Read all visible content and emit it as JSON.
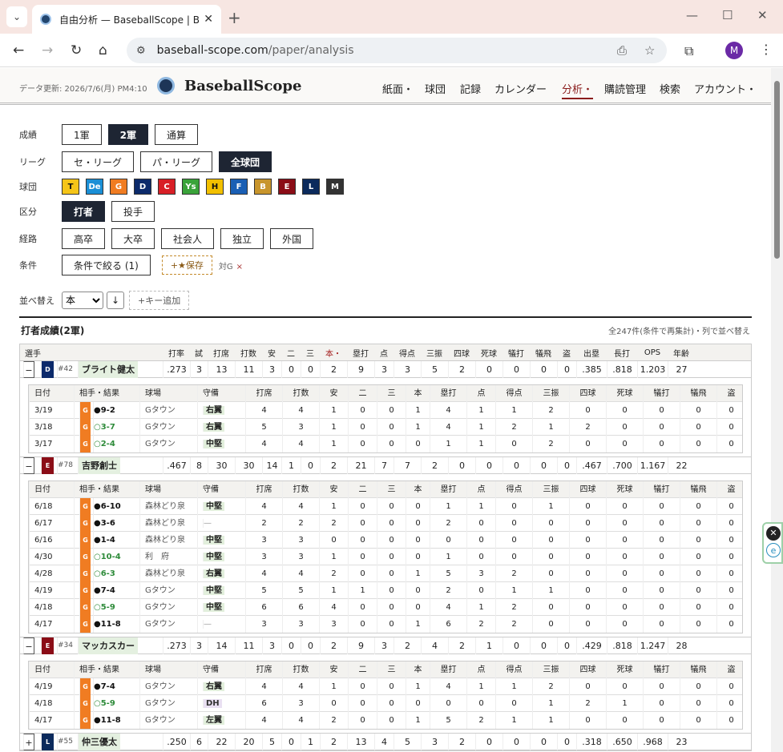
{
  "browser": {
    "tab_title": "自由分析 — BaseballScope | Ba",
    "url_host": "baseball-scope.com",
    "url_path": "/paper/analysis",
    "avatar_letter": "M"
  },
  "header": {
    "updated": "データ更新: 2026/7/6(月) PM4:10",
    "brand": "BaseballScope",
    "nav": [
      "紙面・",
      "球団",
      "記録",
      "カレンダー",
      "分析・",
      "購読管理",
      "検索",
      "アカウント・"
    ]
  },
  "filters": {
    "level_label": "成績",
    "level": [
      "1軍",
      "2軍",
      "通算"
    ],
    "league_label": "リーグ",
    "league": [
      "セ・リーグ",
      "パ・リーグ",
      "全球団"
    ],
    "team_label": "球団",
    "teams": [
      {
        "code": "T",
        "color": "#f5c518",
        "fg": "#111"
      },
      {
        "code": "De",
        "color": "#1a8fd6",
        "fg": "#fff"
      },
      {
        "code": "G",
        "color": "#f07c22",
        "fg": "#fff"
      },
      {
        "code": "D",
        "color": "#0c2a6b",
        "fg": "#fff"
      },
      {
        "code": "C",
        "color": "#d81f26",
        "fg": "#fff"
      },
      {
        "code": "Ys",
        "color": "#3aa33a",
        "fg": "#fff"
      },
      {
        "code": "H",
        "color": "#f2c000",
        "fg": "#111"
      },
      {
        "code": "F",
        "color": "#1a5fb4",
        "fg": "#fff"
      },
      {
        "code": "B",
        "color": "#c8952c",
        "fg": "#fff"
      },
      {
        "code": "E",
        "color": "#8b0d17",
        "fg": "#fff"
      },
      {
        "code": "L",
        "color": "#0b2a5c",
        "fg": "#fff"
      },
      {
        "code": "M",
        "color": "#333333",
        "fg": "#fff"
      }
    ],
    "kubun_label": "区分",
    "kubun": [
      "打者",
      "投手"
    ],
    "route_label": "経路",
    "route": [
      "高卒",
      "大卒",
      "社会人",
      "独立",
      "外国"
    ],
    "cond_label": "条件",
    "cond_button": "条件で絞る (1)",
    "save_button": "+★保存",
    "cond_tag": "対G",
    "cond_remove": "×",
    "sort_label": "並べ替え",
    "sort_value": "本",
    "sort_dir": "↓",
    "sort_add": "+キー追加"
  },
  "results": {
    "title": "打者成績(2軍)",
    "count": "全247件(条件で再集計)・列で並べ替え",
    "columns": [
      "選手",
      "打率",
      "試",
      "打席",
      "打数",
      "安",
      "二",
      "三",
      "本・",
      "塁打",
      "点",
      "得点",
      "三振",
      "四球",
      "死球",
      "犠打",
      "犠飛",
      "盗",
      "出塁",
      "長打",
      "OPS",
      "年齢"
    ],
    "game_columns": [
      "日付",
      "相手・結果",
      "球場",
      "守備",
      "打席",
      "打数",
      "安",
      "二",
      "三",
      "本",
      "塁打",
      "点",
      "得点",
      "三振",
      "四球",
      "死球",
      "犠打",
      "犠飛",
      "盗"
    ],
    "players": [
      {
        "toggle": "−",
        "team": "D",
        "team_color": "#0c2a6b",
        "num": "#42",
        "name": "ブライト健太",
        "stats": [
          ".273",
          "3",
          "13",
          "11",
          "3",
          "0",
          "0",
          "2",
          "9",
          "3",
          "3",
          "5",
          "2",
          "0",
          "0",
          "0",
          "0",
          ".385",
          ".818",
          "1.203",
          "27"
        ],
        "games": [
          {
            "date": "3/19",
            "win": false,
            "result": "●9-2",
            "park": "Gタウン",
            "pos": "右翼",
            "s": [
              "4",
              "4",
              "1",
              "0",
              "0",
              "1",
              "4",
              "1",
              "1",
              "2",
              "0",
              "0",
              "0",
              "0",
              "0"
            ]
          },
          {
            "date": "3/18",
            "win": true,
            "result": "○3-7",
            "park": "Gタウン",
            "pos": "右翼",
            "s": [
              "5",
              "3",
              "1",
              "0",
              "0",
              "1",
              "4",
              "1",
              "2",
              "1",
              "2",
              "0",
              "0",
              "0",
              "0"
            ]
          },
          {
            "date": "3/17",
            "win": true,
            "result": "○2-4",
            "park": "Gタウン",
            "pos": "中堅",
            "s": [
              "4",
              "4",
              "1",
              "0",
              "0",
              "0",
              "1",
              "1",
              "0",
              "2",
              "0",
              "0",
              "0",
              "0",
              "0"
            ]
          }
        ]
      },
      {
        "toggle": "−",
        "team": "E",
        "team_color": "#8b0d17",
        "num": "#78",
        "name": "吉野創士",
        "stats": [
          ".467",
          "8",
          "30",
          "30",
          "14",
          "1",
          "0",
          "2",
          "21",
          "7",
          "7",
          "2",
          "0",
          "0",
          "0",
          "0",
          "0",
          ".467",
          ".700",
          "1.167",
          "22"
        ],
        "games": [
          {
            "date": "6/18",
            "win": false,
            "result": "●6-10",
            "park": "森林どり泉",
            "pos": "中堅",
            "s": [
              "4",
              "4",
              "1",
              "0",
              "0",
              "0",
              "1",
              "1",
              "0",
              "1",
              "0",
              "0",
              "0",
              "0",
              "0"
            ]
          },
          {
            "date": "6/17",
            "win": false,
            "result": "●3-6",
            "park": "森林どり泉",
            "pos": "—",
            "s": [
              "2",
              "2",
              "2",
              "0",
              "0",
              "0",
              "2",
              "0",
              "0",
              "0",
              "0",
              "0",
              "0",
              "0",
              "0"
            ]
          },
          {
            "date": "6/16",
            "win": false,
            "result": "●1-4",
            "park": "森林どり泉",
            "pos": "中堅",
            "s": [
              "3",
              "3",
              "0",
              "0",
              "0",
              "0",
              "0",
              "0",
              "0",
              "0",
              "0",
              "0",
              "0",
              "0",
              "0"
            ]
          },
          {
            "date": "4/30",
            "win": true,
            "result": "○10-4",
            "park": "利　府",
            "pos": "中堅",
            "s": [
              "3",
              "3",
              "1",
              "0",
              "0",
              "0",
              "1",
              "0",
              "0",
              "0",
              "0",
              "0",
              "0",
              "0",
              "0"
            ]
          },
          {
            "date": "4/28",
            "win": true,
            "result": "○6-3",
            "park": "森林どり泉",
            "pos": "右翼",
            "s": [
              "4",
              "4",
              "2",
              "0",
              "0",
              "1",
              "5",
              "3",
              "2",
              "0",
              "0",
              "0",
              "0",
              "0",
              "0"
            ]
          },
          {
            "date": "4/19",
            "win": false,
            "result": "●7-4",
            "park": "Gタウン",
            "pos": "中堅",
            "s": [
              "5",
              "5",
              "1",
              "1",
              "0",
              "0",
              "2",
              "0",
              "1",
              "1",
              "0",
              "0",
              "0",
              "0",
              "0"
            ]
          },
          {
            "date": "4/18",
            "win": true,
            "result": "○5-9",
            "park": "Gタウン",
            "pos": "中堅",
            "s": [
              "6",
              "6",
              "4",
              "0",
              "0",
              "0",
              "4",
              "1",
              "2",
              "0",
              "0",
              "0",
              "0",
              "0",
              "0"
            ]
          },
          {
            "date": "4/17",
            "win": false,
            "result": "●11-8",
            "park": "Gタウン",
            "pos": "—",
            "s": [
              "3",
              "3",
              "3",
              "0",
              "0",
              "1",
              "6",
              "2",
              "2",
              "0",
              "0",
              "0",
              "0",
              "0",
              "0"
            ]
          }
        ]
      },
      {
        "toggle": "−",
        "team": "E",
        "team_color": "#8b0d17",
        "num": "#34",
        "name": "マッカスカー",
        "stats": [
          ".273",
          "3",
          "14",
          "11",
          "3",
          "0",
          "0",
          "2",
          "9",
          "3",
          "2",
          "4",
          "2",
          "1",
          "0",
          "0",
          "0",
          ".429",
          ".818",
          "1.247",
          "28"
        ],
        "games": [
          {
            "date": "4/19",
            "win": false,
            "result": "●7-4",
            "park": "Gタウン",
            "pos": "右翼",
            "s": [
              "4",
              "4",
              "1",
              "0",
              "0",
              "1",
              "4",
              "1",
              "1",
              "2",
              "0",
              "0",
              "0",
              "0",
              "0"
            ]
          },
          {
            "date": "4/18",
            "win": true,
            "result": "○5-9",
            "park": "Gタウン",
            "pos": "DH",
            "s": [
              "6",
              "3",
              "0",
              "0",
              "0",
              "0",
              "0",
              "0",
              "0",
              "1",
              "2",
              "1",
              "0",
              "0",
              "0"
            ]
          },
          {
            "date": "4/17",
            "win": false,
            "result": "●11-8",
            "park": "Gタウン",
            "pos": "左翼",
            "s": [
              "4",
              "4",
              "2",
              "0",
              "0",
              "1",
              "5",
              "2",
              "1",
              "1",
              "0",
              "0",
              "0",
              "0",
              "0"
            ]
          }
        ]
      },
      {
        "toggle": "+",
        "team": "L",
        "team_color": "#0b2a5c",
        "num": "#55",
        "name": "仲三優太",
        "stats": [
          ".250",
          "6",
          "22",
          "20",
          "5",
          "0",
          "1",
          "2",
          "13",
          "4",
          "5",
          "3",
          "2",
          "0",
          "0",
          "0",
          "0",
          ".318",
          ".650",
          ".968",
          "23"
        ],
        "games": []
      }
    ]
  },
  "widget": {
    "close": "✕",
    "e": "e"
  }
}
